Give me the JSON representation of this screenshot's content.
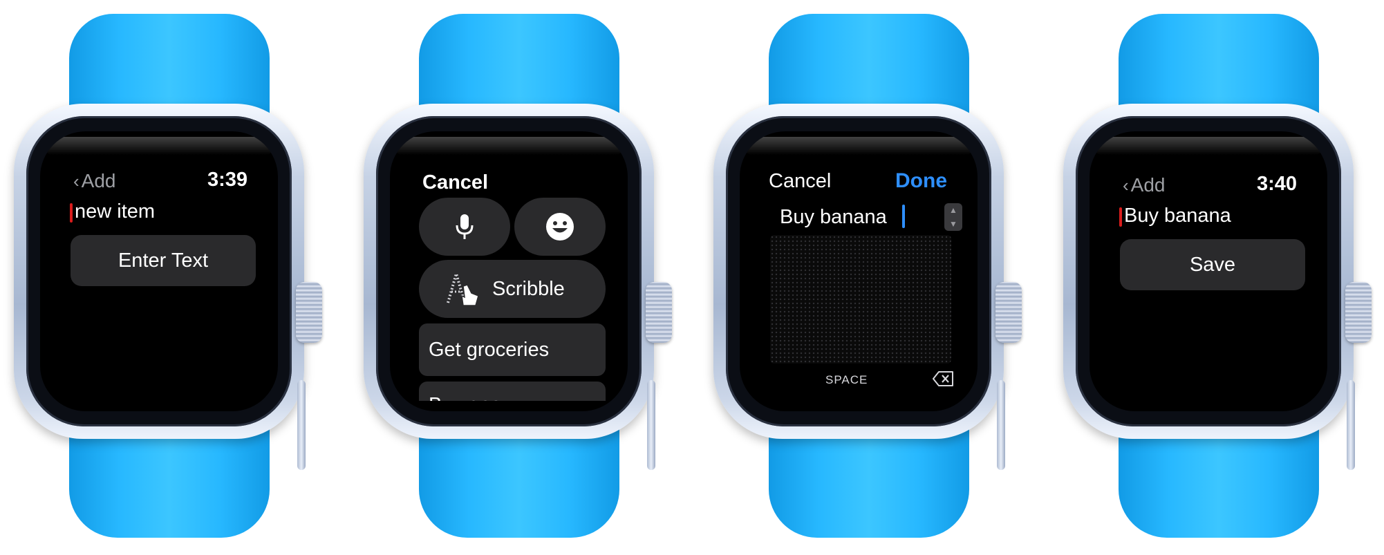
{
  "watch1": {
    "back_label": "Add",
    "time": "3:39",
    "text_value": "new item",
    "button_label": "Enter Text"
  },
  "watch2": {
    "cancel_label": "Cancel",
    "scribble_label": "Scribble",
    "suggestions": [
      "Get groceries",
      "Buy gas"
    ]
  },
  "watch3": {
    "cancel_label": "Cancel",
    "done_label": "Done",
    "text_value": "Buy banana",
    "space_label": "SPACE"
  },
  "watch4": {
    "back_label": "Add",
    "time": "3:40",
    "text_value": "Buy banana",
    "button_label": "Save"
  },
  "colors": {
    "band": "#27b8ff",
    "accent_blue": "#2e8fff",
    "cursor_red": "#d81c1c",
    "button_bg": "#2a2a2c"
  }
}
